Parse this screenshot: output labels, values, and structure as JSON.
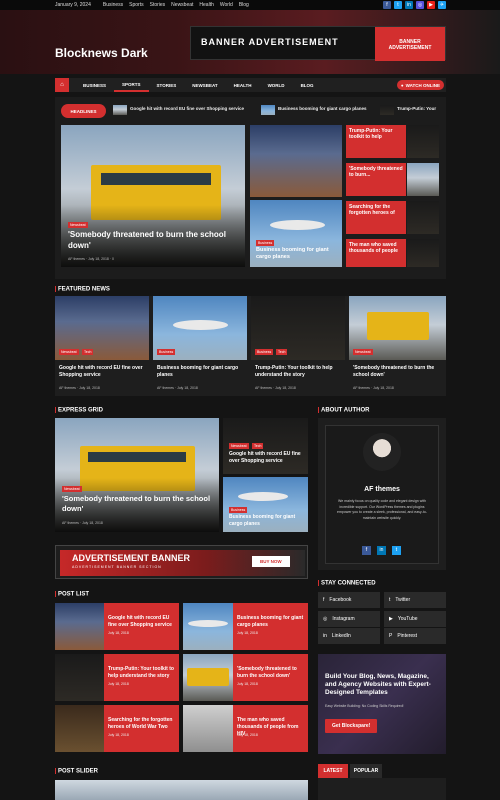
{
  "topbar": {
    "date": "January 9, 2024",
    "links": [
      "Business",
      "Sports",
      "Stories",
      "Newsbeat",
      "Health",
      "World",
      "Blog"
    ]
  },
  "site": {
    "title": "Blocknews Dark"
  },
  "header_banner": {
    "title": "BANNER ADVERTISEMENT",
    "sub": "BANNER ADVERTISEMENT"
  },
  "nav": {
    "items": [
      "BUSINESS",
      "SPORTS",
      "STORIES",
      "NEWSBEAT",
      "HEALTH",
      "WORLD",
      "BLOG"
    ],
    "watch": "WATCH ONLINE"
  },
  "headlines": {
    "label": "HEADLINES",
    "items": [
      "Google hit with record EU fine over Shopping service",
      "Business booming for giant cargo planes",
      "Trump-Putin: Your"
    ]
  },
  "hero": {
    "cat": "Newsbeat",
    "title": "'Somebody threatened to burn the school down'",
    "author": "AF themes",
    "date": "July 18, 2018",
    "comments": "0"
  },
  "hero_small": {
    "cat": "Business",
    "title": "Business booming for giant cargo planes"
  },
  "side_list": [
    "Trump-Putin: Your toolkit to help",
    "'Somebody threatened to burn...",
    "Searching for the forgotten heroes of",
    "The man who saved thousands of people"
  ],
  "featured": {
    "title": "FEATURED NEWS",
    "items": [
      {
        "cat": "Newsbeat",
        "cat2": "Tech",
        "title": "Google hit with record EU fine over Shopping service",
        "author": "AF themes",
        "date": "July 18, 2018"
      },
      {
        "cat": "Business",
        "title": "Business booming for giant cargo planes",
        "author": "AF themes",
        "date": "July 18, 2018"
      },
      {
        "cat": "Business",
        "cat2": "Tech",
        "title": "Trump-Putin: Your toolkit to help understand the story",
        "author": "AF themes",
        "date": "July 18, 2018"
      },
      {
        "cat": "Newsbeat",
        "title": "'Somebody threatened to burn the school down'",
        "author": "AF themes",
        "date": "July 18, 2018"
      }
    ]
  },
  "express": {
    "title": "EXPRESS GRID",
    "main": {
      "cat": "Newsbeat",
      "title": "'Somebody threatened to burn the school down'",
      "author": "AF themes",
      "date": "July 18, 2018"
    },
    "s1": {
      "cat": "Newsbeat",
      "cat2": "Tech",
      "title": "Google hit with record EU fine over Shopping service"
    },
    "s2": {
      "cat": "Business",
      "title": "Business booming for giant cargo planes"
    }
  },
  "ad": {
    "title": "ADVERTISEMENT BANNER",
    "sub": "ADVERTISEMENT BANNER SECTION",
    "btn": "BUY NOW"
  },
  "about": {
    "title": "ABOUT AUTHOR",
    "name": "AF themes",
    "text": "We mainly focus on quality code and elegant design with incredible support. Our WordPress themes and plugins empower you to create a sleek, professional, and easy-to-maintain website quickly."
  },
  "connect": {
    "title": "STAY CONNECTED",
    "items": [
      "Facebook",
      "Twitter",
      "Instagram",
      "YouTube",
      "LinkedIn",
      "Pinterest"
    ]
  },
  "promo": {
    "title": "Build Your Blog, News, Magazine, and Agency Websites with Expert-Designed Templates",
    "sub": "Easy Website Building: No Coding Skills Required!",
    "btn": "Get Blockspare!"
  },
  "tabs": [
    "LATEST",
    "POPULAR"
  ],
  "postlist": {
    "title": "POST LIST",
    "items": [
      {
        "title": "Google hit with record EU fine over Shopping service",
        "date": "July 18, 2018"
      },
      {
        "title": "Business booming for giant cargo planes",
        "date": "July 18, 2018"
      },
      {
        "title": "Trump-Putin: Your toolkit to help understand the story",
        "date": "July 18, 2018"
      },
      {
        "title": "'Somebody threatened to burn the school down'",
        "date": "July 18, 2018"
      },
      {
        "title": "Searching for the forgotten heroes of World War Two",
        "date": "July 18, 2018"
      },
      {
        "title": "The man who saved thousands of people from HIV",
        "date": "July 18, 2018"
      }
    ]
  },
  "slider": {
    "title": "POST SLIDER"
  },
  "colors": {
    "accent": "#d32f2f",
    "bg": "#141414"
  }
}
